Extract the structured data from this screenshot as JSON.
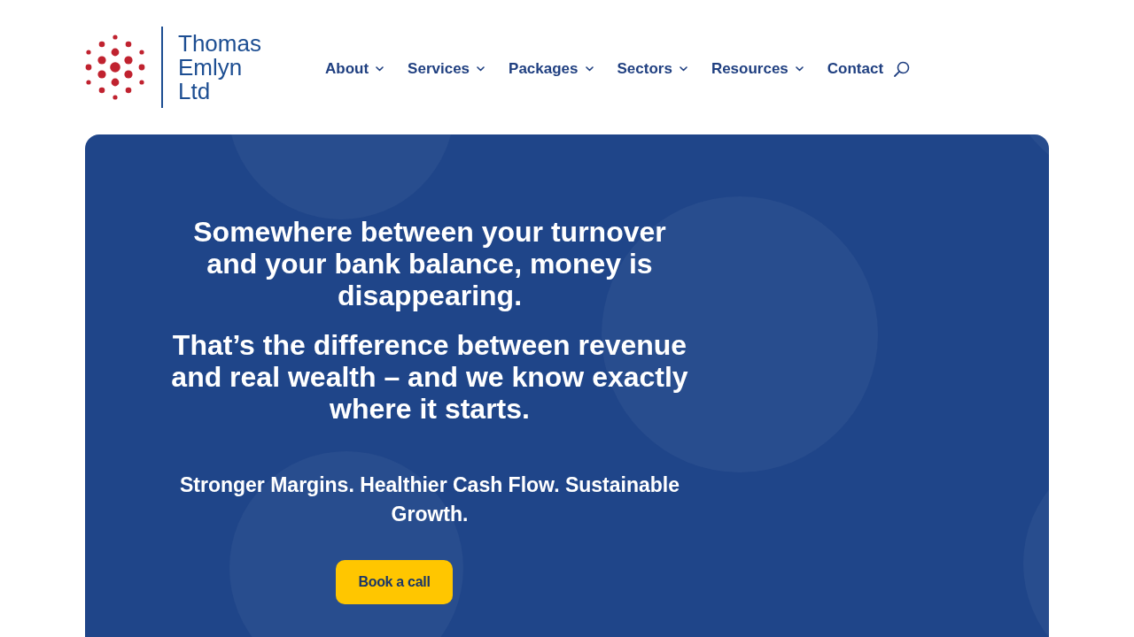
{
  "logo": {
    "text": "Thomas Emlyn Ltd"
  },
  "nav": {
    "items": [
      {
        "label": "About",
        "has_dropdown": true
      },
      {
        "label": "Services",
        "has_dropdown": true
      },
      {
        "label": "Packages",
        "has_dropdown": true
      },
      {
        "label": "Sectors",
        "has_dropdown": true
      },
      {
        "label": "Resources",
        "has_dropdown": true
      },
      {
        "label": "Contact",
        "has_dropdown": false
      }
    ]
  },
  "hero": {
    "headings": [
      "Somewhere between your turnover and your bank balance, money is disappearing.",
      "That’s the difference between revenue and real wealth – and we know exactly where it starts."
    ],
    "tagline": "Stronger Margins. Healthier Cash Flow. Sustainable Growth.",
    "cta": {
      "label": "Book a call"
    }
  }
}
